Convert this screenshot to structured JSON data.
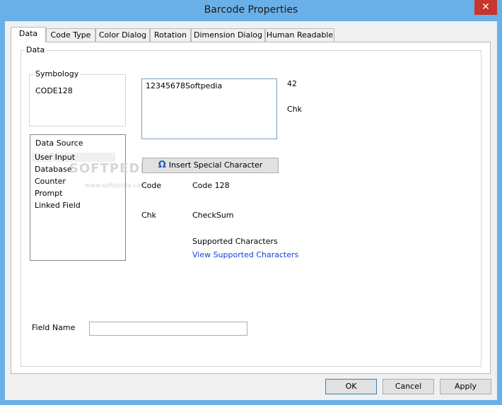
{
  "window": {
    "title": "Barcode Properties",
    "close_glyph": "✕"
  },
  "tabs": [
    {
      "label": "Data"
    },
    {
      "label": "Code Type"
    },
    {
      "label": "Color Dialog"
    },
    {
      "label": "Rotation"
    },
    {
      "label": "Dimension Dialog"
    },
    {
      "label": "Human Readable"
    }
  ],
  "data_group": {
    "label": "Data",
    "symbology": {
      "label": "Symbology",
      "value": "CODE128"
    },
    "data_source": {
      "label": "Data Source",
      "items": [
        "User Input",
        "Database",
        "Counter",
        "Prompt",
        "Linked Field"
      ],
      "selected": "User Input"
    },
    "data_input": {
      "value": "12345678Softpedia"
    },
    "length_value": "42",
    "chk_label_right": "Chk",
    "insert_special_button": {
      "label": "Insert Special Character",
      "icon": "omega-icon"
    },
    "code_label": "Code",
    "code_value": "Code 128",
    "chk_label": "Chk",
    "checksum_value": "CheckSum",
    "supported_label": "Supported Characters",
    "supported_link": "View Supported Characters",
    "field_name_label": "Field Name",
    "field_name_value": ""
  },
  "watermark": {
    "text": "SOFTPEDIA",
    "url_text": "www.softpedia.com"
  },
  "footer": {
    "ok_label": "OK",
    "cancel_label": "Cancel",
    "apply_label": "Apply"
  },
  "colors": {
    "titlebar": "#6ab0e8",
    "close": "#c7352c",
    "link": "#1a3fd4"
  }
}
